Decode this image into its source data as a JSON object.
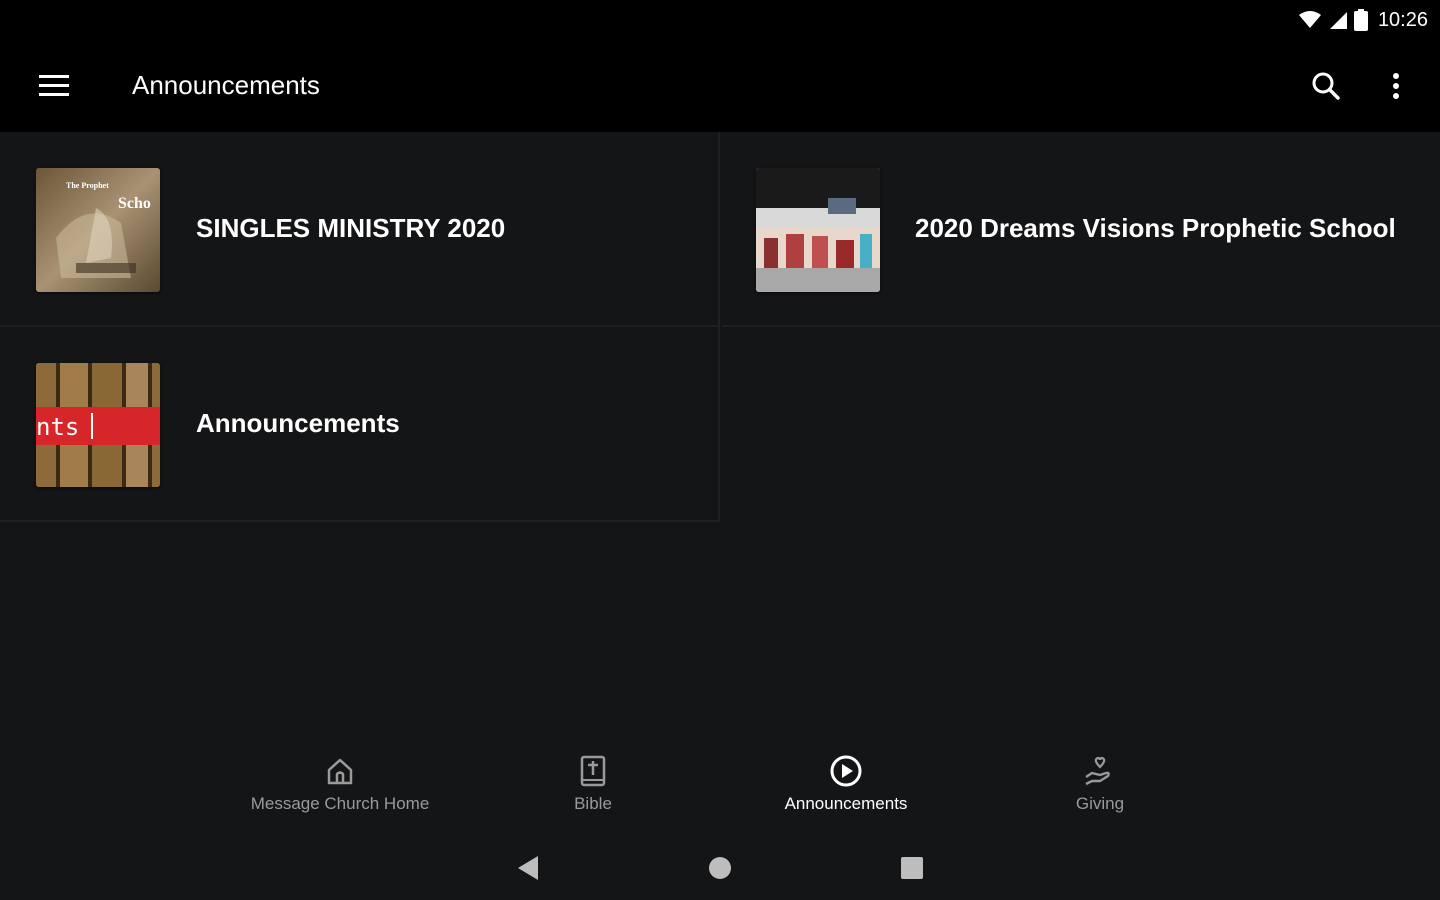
{
  "status_bar": {
    "time": "10:26",
    "icons": [
      "wifi-icon",
      "signal-icon",
      "battery-icon"
    ]
  },
  "app_bar": {
    "title": "Announcements",
    "icons": [
      "menu-icon",
      "search-icon",
      "more-vert-icon"
    ]
  },
  "cards": [
    {
      "title": "SINGLES MINISTRY 2020",
      "thumb_text_1": "The Prophet",
      "thumb_text_2": "Scho"
    },
    {
      "title": "2020 Dreams Visions Prophetic School"
    },
    {
      "title": "Announcements",
      "thumb_text_1": "nts"
    }
  ],
  "bottom_nav": {
    "items": [
      {
        "label": "Message Church Home",
        "icon": "home-icon",
        "active": false
      },
      {
        "label": "Bible",
        "icon": "bible-icon",
        "active": false
      },
      {
        "label": "Announcements",
        "icon": "play-circle-icon",
        "active": true
      },
      {
        "label": "Giving",
        "icon": "giving-hand-icon",
        "active": false
      }
    ]
  },
  "colors": {
    "background": "#141517",
    "app_bar": "#000000",
    "active_label": "#ffffff",
    "inactive_label": "#9a9a9a",
    "thumb_banner_red": "#d6262a"
  }
}
